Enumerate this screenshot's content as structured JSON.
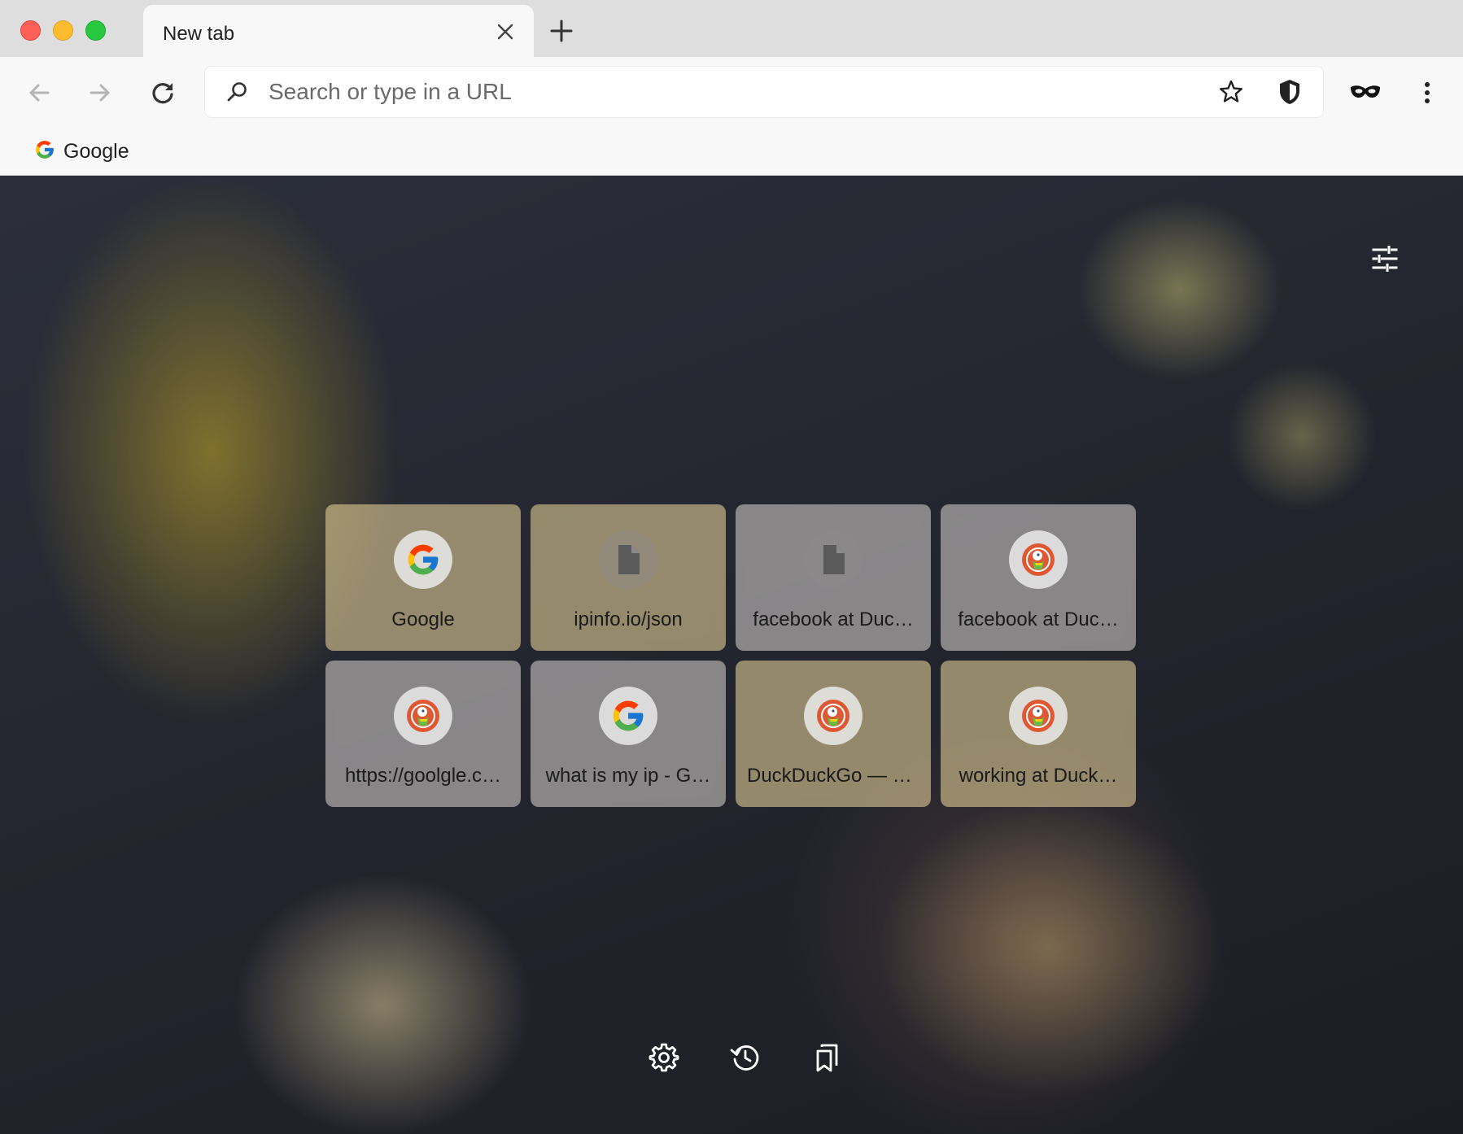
{
  "browser": {
    "tab": {
      "title": "New tab",
      "close_icon": "close-icon"
    },
    "new_tab_icon": "plus-icon",
    "toolbar": {
      "back_icon": "arrow-left-icon",
      "forward_icon": "arrow-right-icon",
      "reload_icon": "reload-icon",
      "omnibox": {
        "placeholder": "Search or type in a URL",
        "value": ""
      },
      "bookmark_star_icon": "star-icon",
      "shield_icon": "shield-icon",
      "incognito_icon": "mask-icon",
      "menu_icon": "kebab-menu-icon"
    },
    "bookmarks_bar": [
      {
        "label": "Google",
        "icon": "google-g-icon"
      }
    ]
  },
  "new_tab_page": {
    "customize_icon": "sliders-icon",
    "shortcuts": [
      {
        "title": "Google",
        "icon": "google-g-icon"
      },
      {
        "title": "ipinfo.io/json",
        "icon": "document-icon"
      },
      {
        "title": "facebook at Duc…",
        "icon": "document-icon"
      },
      {
        "title": "facebook at Duc…",
        "icon": "duckduckgo-icon"
      },
      {
        "title": "https://goolgle.c…",
        "icon": "duckduckgo-icon"
      },
      {
        "title": "what is my ip - G…",
        "icon": "google-g-icon"
      },
      {
        "title": "DuckDuckGo — P…",
        "icon": "duckduckgo-icon"
      },
      {
        "title": "working at Duck…",
        "icon": "duckduckgo-icon"
      }
    ],
    "footer": {
      "settings_icon": "gear-icon",
      "history_icon": "history-icon",
      "bookmarks_icon": "bookmarks-icon"
    }
  },
  "colors": {
    "window_traffic": [
      "#fe5f57",
      "#febc2e",
      "#28c840"
    ],
    "toolbar_bg": "#f8f8f8",
    "tabstrip_bg": "#dedede",
    "ddg_orange": "#de5833"
  }
}
